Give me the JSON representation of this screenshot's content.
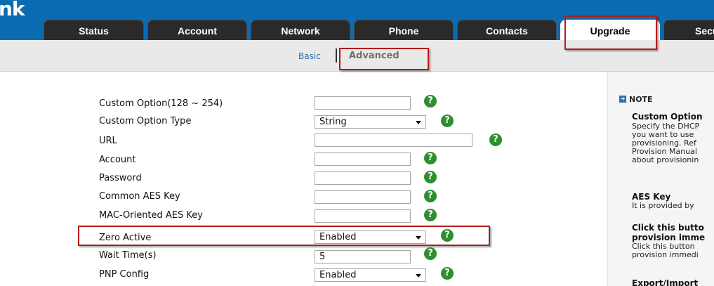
{
  "header": {
    "logo_text": "nk",
    "colors": {
      "bar": "#0b6bb0",
      "tab": "#2a2a2a"
    },
    "tabs": [
      {
        "label": "Status"
      },
      {
        "label": "Account"
      },
      {
        "label": "Network"
      },
      {
        "label": "Phone"
      },
      {
        "label": "Contacts"
      },
      {
        "label": "Upgrade"
      },
      {
        "label": "Secu"
      }
    ]
  },
  "subnav": {
    "basic": "Basic",
    "advanced": "Advanced"
  },
  "form": {
    "rows": [
      {
        "label": "Custom Option(128 ~ 254)",
        "value": ""
      },
      {
        "label": "Custom Option Type",
        "value": "String"
      },
      {
        "label": "URL",
        "value": ""
      },
      {
        "label": "Account",
        "value": ""
      },
      {
        "label": "Password",
        "value": ""
      },
      {
        "label": "Common AES Key",
        "value": ""
      },
      {
        "label": "MAC-Oriented AES Key",
        "value": ""
      },
      {
        "label": "Zero Active",
        "value": "Enabled"
      },
      {
        "label": "Wait Time(s)",
        "value": "5"
      },
      {
        "label": "PNP Config",
        "value": "Enabled"
      }
    ],
    "help_glyph": "?"
  },
  "note": {
    "heading": "NOTE",
    "icon_glyph": "➜",
    "sections": [
      {
        "title": "Custom Option",
        "lines": [
          "Specify the DHCP",
          "you want to use",
          "provisioning. Ref",
          "Provision Manual",
          "about provisionin"
        ]
      },
      {
        "title": "AES Key",
        "lines": [
          "It is provided by"
        ]
      },
      {
        "title": "Click this butto",
        "title2": "provision imme",
        "lines": [
          "Click this button",
          "provision immedi"
        ]
      },
      {
        "title": "Export/Import"
      }
    ]
  }
}
